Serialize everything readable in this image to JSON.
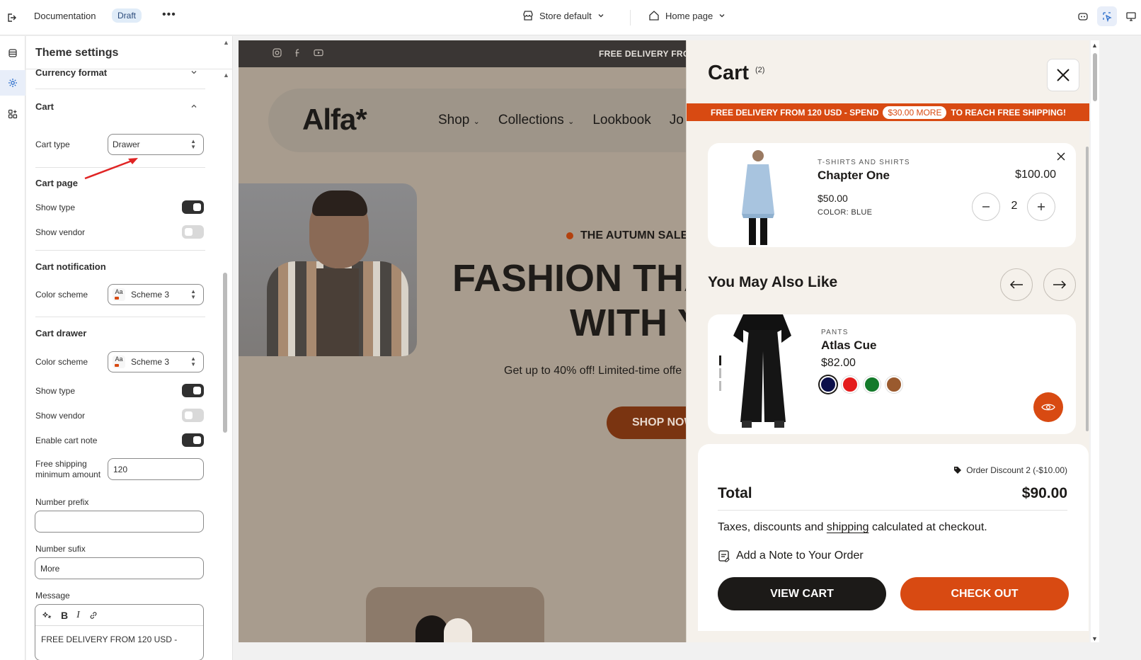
{
  "topbar": {
    "doc_title": "Documentation",
    "draft_badge": "Draft",
    "more": "•••",
    "store_label": "Store default",
    "page_label": "Home page"
  },
  "panel": {
    "title": "Theme settings",
    "currency_section": "Currency format",
    "cart_section": "Cart",
    "cart_type_label": "Cart type",
    "cart_type_value": "Drawer",
    "cart_page_heading": "Cart page",
    "cart_page_show_type": {
      "label": "Show type",
      "on": true
    },
    "cart_page_show_vendor": {
      "label": "Show vendor",
      "on": false
    },
    "cart_notification_heading": "Cart notification",
    "notif_color_label": "Color scheme",
    "notif_color_value": "Scheme 3",
    "cart_drawer_heading": "Cart drawer",
    "drawer_color_label": "Color scheme",
    "drawer_color_value": "Scheme 3",
    "drawer_show_type": {
      "label": "Show type",
      "on": true
    },
    "drawer_show_vendor": {
      "label": "Show vendor",
      "on": false
    },
    "drawer_cart_note": {
      "label": "Enable cart note",
      "on": true
    },
    "free_shipping_label_1": "Free shipping",
    "free_shipping_label_2": "minimum amount",
    "free_shipping_value": "120",
    "number_prefix_label": "Number prefix",
    "number_prefix_value": "",
    "number_sufix_label": "Number sufix",
    "number_sufix_value": "More",
    "message_label": "Message",
    "message_value": "FREE DELIVERY FROM 120 USD -",
    "aa": "Aa"
  },
  "preview": {
    "announcement": "FREE DELIVERY FROM",
    "logo": "Alfa*",
    "nav": [
      "Shop",
      "Collections",
      "Lookbook",
      "Jo"
    ],
    "kicker": "THE AUTUMN SALE",
    "title_line1": "FASHION THA",
    "title_line2": "WITH Y",
    "subtitle": "Get up to 40% off! Limited-time offe",
    "cta": "SHOP NOW"
  },
  "cart": {
    "title": "Cart",
    "count": "(2)",
    "free_bar_before": "FREE DELIVERY FROM 120 USD - SPEND",
    "free_bar_amount": "$30.00 MORE",
    "free_bar_after": "TO REACH FREE SHIPPING!",
    "item": {
      "category": "T-SHIRTS AND SHIRTS",
      "name": "Chapter One",
      "price": "$50.00",
      "color": "COLOR: BLUE",
      "line_total": "$100.00",
      "quantity": "2"
    },
    "recommend_heading": "You May Also Like",
    "rec": {
      "category": "PANTS",
      "name": "Atlas Cue",
      "price": "$82.00",
      "swatches": [
        "#0b0f4a",
        "#e41b1b",
        "#137a2a",
        "#9a5a2e"
      ]
    },
    "discount": "Order Discount 2 (-$10.00)",
    "total_label": "Total",
    "total_value": "$90.00",
    "taxes_before": "Taxes, discounts and",
    "taxes_link": "shipping",
    "taxes_after": "calculated at checkout.",
    "note": "Add a Note to Your Order",
    "view_cart": "VIEW CART",
    "checkout": "CHECK OUT"
  },
  "colors": {
    "accent": "#d84a12",
    "dark": "#1c1a18",
    "announcement_bg": "#3a3634"
  }
}
